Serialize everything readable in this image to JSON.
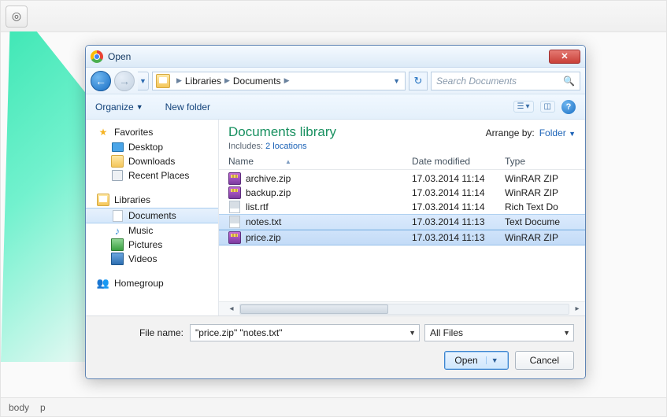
{
  "app": {
    "status": [
      "body",
      "p"
    ]
  },
  "dialog": {
    "title": "Open",
    "breadcrumbs": [
      "Libraries",
      "Documents"
    ],
    "search_placeholder": "Search Documents",
    "toolbar": {
      "organize": "Organize",
      "new_folder": "New folder"
    },
    "sidebar": {
      "favorites": {
        "label": "Favorites",
        "items": [
          "Desktop",
          "Downloads",
          "Recent Places"
        ]
      },
      "libraries": {
        "label": "Libraries",
        "items": [
          "Documents",
          "Music",
          "Pictures",
          "Videos"
        ],
        "selected": "Documents"
      },
      "homegroup": {
        "label": "Homegroup"
      }
    },
    "library": {
      "heading": "Documents library",
      "includes_label": "Includes:",
      "includes_link": "2 locations",
      "arrange_label": "Arrange by:",
      "arrange_value": "Folder"
    },
    "columns": [
      "Name",
      "Date modified",
      "Type"
    ],
    "files": [
      {
        "name": "archive.zip",
        "date": "17.03.2014 11:14",
        "type": "WinRAR ZIP",
        "icon": "zip",
        "selected": false
      },
      {
        "name": "backup.zip",
        "date": "17.03.2014 11:14",
        "type": "WinRAR ZIP",
        "icon": "zip",
        "selected": false
      },
      {
        "name": "list.rtf",
        "date": "17.03.2014 11:14",
        "type": "Rich Text Do",
        "icon": "txt",
        "selected": false
      },
      {
        "name": "notes.txt",
        "date": "17.03.2014 11:13",
        "type": "Text Docume",
        "icon": "txt",
        "selected": true
      },
      {
        "name": "price.zip",
        "date": "17.03.2014 11:13",
        "type": "WinRAR ZIP",
        "icon": "zip",
        "selected": true
      }
    ],
    "filename_label": "File name:",
    "filename_value": "\"price.zip\" \"notes.txt\"",
    "filter_value": "All Files",
    "open_label": "Open",
    "cancel_label": "Cancel"
  }
}
